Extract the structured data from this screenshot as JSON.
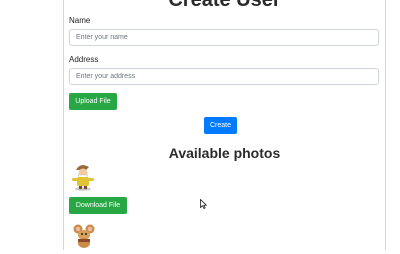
{
  "header": {
    "title": "Create User"
  },
  "form": {
    "name_label": "Name",
    "name_placeholder": "Enter your name",
    "name_value": "",
    "address_label": "Address",
    "address_placeholder": "Enter your address",
    "address_value": "",
    "upload_label": "Upload File",
    "create_label": "Create"
  },
  "photos": {
    "title": "Available photos",
    "items": [
      {
        "icon": "cartoon-dwarf-icon",
        "download_label": "Download File"
      },
      {
        "icon": "cartoon-mouse-icon"
      }
    ]
  },
  "colors": {
    "success": "#28a745",
    "primary": "#007bff",
    "border": "#ced4da"
  }
}
